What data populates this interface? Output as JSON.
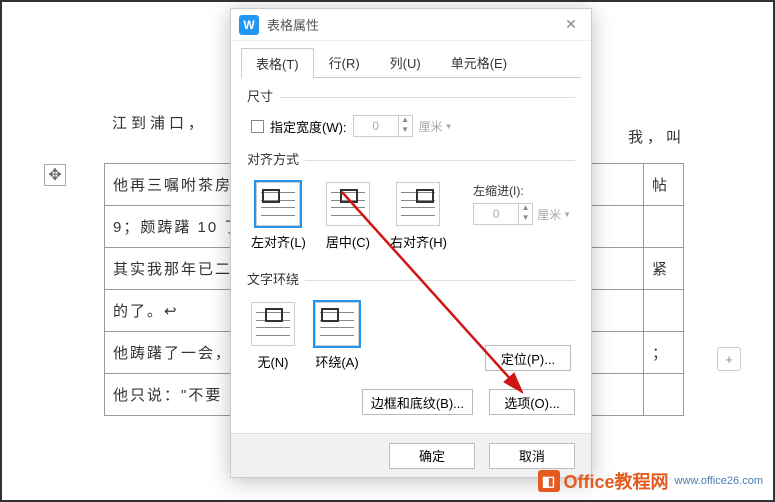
{
  "dialog": {
    "title": "表格属性",
    "tabs": {
      "table": "表格(T)",
      "row": "行(R)",
      "column": "列(U)",
      "cell": "单元格(E)"
    },
    "size": {
      "label": "尺寸",
      "specify_width": "指定宽度(W):",
      "width_value": "0",
      "unit": "厘米"
    },
    "alignment": {
      "label": "对齐方式",
      "left": "左对齐(L)",
      "center": "居中(C)",
      "right": "右对齐(H)",
      "indent_label": "左缩进(I):",
      "indent_value": "0",
      "indent_unit": "厘米"
    },
    "wrap": {
      "label": "文字环绕",
      "none": "无(N)",
      "around": "环绕(A)"
    },
    "buttons": {
      "position": "定位(P)...",
      "border": "边框和底纹(B)...",
      "options": "选项(O)...",
      "ok": "确定",
      "cancel": "取消"
    }
  },
  "doc": {
    "line1": "江到浦口，",
    "frag_right": "我，叫",
    "rows": [
      "他再三嘱咐茶房",
      "9；颇踌躇 10 了",
      "其实我那年已二",
      "的了。↩",
      "他踌躇了一会，",
      "他只说：\"不要"
    ],
    "rows_right": [
      "帖",
      "",
      "紧",
      "",
      "；",
      ""
    ]
  },
  "watermark": {
    "brand": "Office",
    "suffix": "教程网",
    "url": "www.office26.com"
  }
}
